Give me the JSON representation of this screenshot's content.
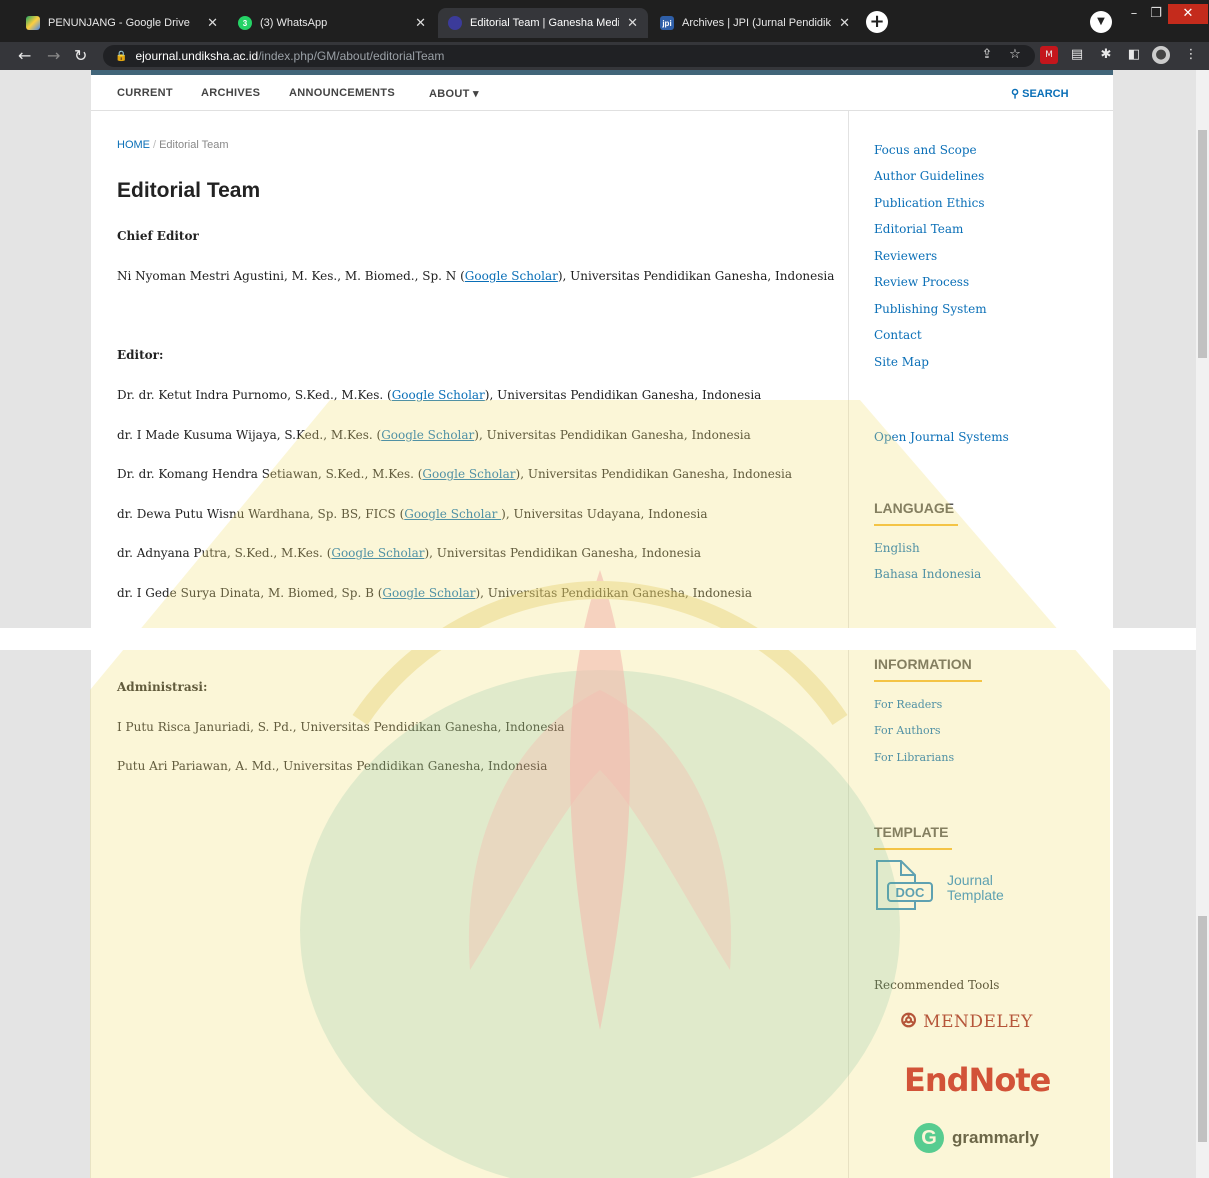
{
  "browser": {
    "tabs": [
      {
        "title": "PENUNJANG - Google Drive",
        "active": false
      },
      {
        "title": "(3) WhatsApp",
        "active": false
      },
      {
        "title": "Editorial Team | Ganesha Medicin",
        "active": true
      },
      {
        "title": "Archives | JPI (Jurnal Pendidikan I",
        "active": false
      }
    ],
    "url_host": "ejournal.undiksha.ac.id",
    "url_path": "/index.php/GM/about/editorialTeam"
  },
  "site_nav": {
    "items": [
      "CURRENT",
      "ARCHIVES",
      "ANNOUNCEMENTS",
      "ABOUT ▾"
    ],
    "search": "SEARCH"
  },
  "breadcrumb": {
    "home": "HOME",
    "separator": "/",
    "current": "Editorial Team"
  },
  "title": "Editorial Team",
  "sections": {
    "chief_editor": {
      "heading": "Chief Editor",
      "members": [
        {
          "before": "Ni Nyoman Mestri Agustini, M. Kes., M. Biomed., Sp. N (",
          "link": "Google Scholar",
          "after": "), Universitas Pendidikan Ganesha, Indonesia"
        }
      ]
    },
    "editor": {
      "heading": "Editor:",
      "members": [
        {
          "before": "Dr. dr. Ketut Indra Purnomo, S.Ked., M.Kes. (",
          "link": "Google Scholar",
          "after": "), Universitas Pendidikan Ganesha, Indonesia"
        },
        {
          "before": "dr. I Made Kusuma Wijaya, S.Ked., M.Kes. (",
          "link": "Google Scholar",
          "after": "), Universitas Pendidikan Ganesha, Indonesia"
        },
        {
          "before": "Dr. dr. Komang Hendra Setiawan, S.Ked., M.Kes. (",
          "link": "Google Scholar",
          "after": "), Universitas Pendidikan Ganesha, Indonesia"
        },
        {
          "before": "dr. Dewa Putu Wisnu Wardhana, Sp. BS, FICS (",
          "link": "Google Scholar ",
          "after": "), Universitas Udayana, Indonesia"
        },
        {
          "before": "dr. Adnyana Putra, S.Ked., M.Kes. (",
          "link": "Google Scholar",
          "after": "), Universitas Pendidikan Ganesha, Indonesia"
        },
        {
          "before": "dr. I Gede Surya Dinata, M. Biomed, Sp. B (",
          "link": "Google Scholar",
          "after": "), Universitas Pendidikan Ganesha, Indonesia"
        }
      ]
    },
    "administration": {
      "heading": "Administrasi:",
      "members": [
        "I Putu Risca Januriadi, S. Pd., Universitas Pendidikan Ganesha, Indonesia",
        "Putu Ari Pariawan, A. Md., Universitas Pendidikan Ganesha, Indonesia"
      ]
    }
  },
  "sidebar": {
    "links": [
      "Focus and Scope",
      "Author Guidelines",
      "Publication Ethics",
      "Editorial Team",
      "Reviewers",
      "Review Process",
      "Publishing System",
      "Contact",
      "Site Map"
    ],
    "ojs": "Open Journal Systems",
    "language": {
      "title": "LANGUAGE",
      "items": [
        "English",
        "Bahasa Indonesia"
      ]
    },
    "information": {
      "title": "INFORMATION",
      "items": [
        "For Readers",
        "For Authors",
        "For Librarians"
      ]
    },
    "template": {
      "title": "TEMPLATE",
      "icon_text": "DOC",
      "label_line1": "Journal",
      "label_line2": "Template"
    },
    "tools": {
      "title": "Recommended Tools",
      "mendeley": "MENDELEY",
      "endnote": "EndNote",
      "grammarly": "grammarly"
    }
  },
  "colors": {
    "accent": "#0a6fb7",
    "topbar": "#416579",
    "underline": "#f5b82e",
    "watermark_yellow": "#f3e07a",
    "watermark_green": "#8fc48a",
    "watermark_red": "#e9846e"
  }
}
